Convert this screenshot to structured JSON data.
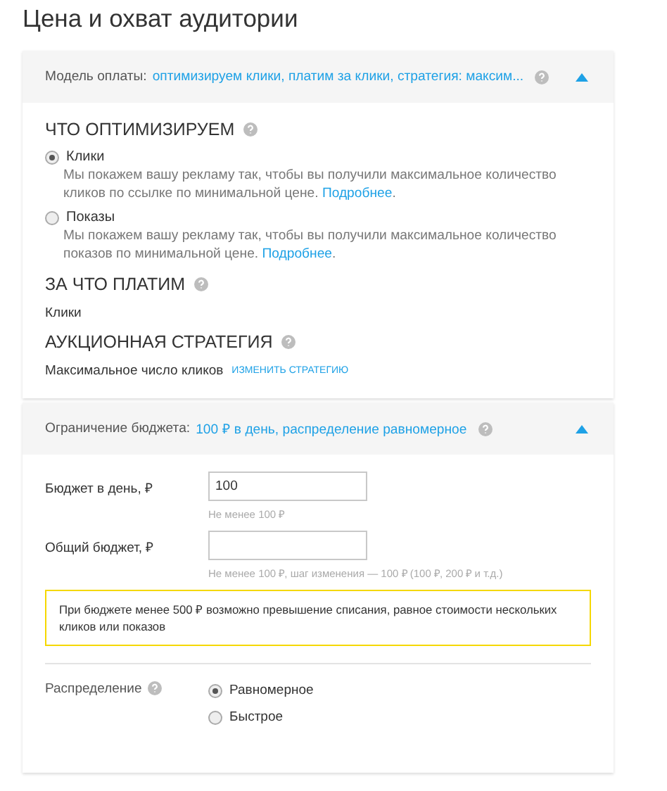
{
  "title": "Цена и охват аудитории",
  "payment": {
    "header_label": "Модель оплаты:",
    "header_value": "оптимизируем клики, платим за клики, стратегия: максим...",
    "expanded": true,
    "optimize": {
      "heading": "ЧТО ОПТИМИЗИРУЕМ",
      "options": [
        {
          "label": "Клики",
          "selected": true,
          "description": "Мы покажем вашу рекламу так, чтобы вы получили максимальное количество кликов по ссылке по минимальной цене.",
          "link": "Подробнее",
          "after_link": "."
        },
        {
          "label": "Показы",
          "selected": false,
          "description": "Мы покажем вашу рекламу так, чтобы вы получили максимальное количество показов по минимальной цене.",
          "link": "Подробнее",
          "after_link": "."
        }
      ]
    },
    "pay_for": {
      "heading": "ЗА ЧТО ПЛАТИМ",
      "value": "Клики"
    },
    "strategy": {
      "heading": "АУКЦИОННАЯ СТРАТЕГИЯ",
      "value": "Максимальное число кликов",
      "link": "ИЗМЕНИТЬ СТРАТЕГИЮ"
    }
  },
  "budget": {
    "header_label": "Ограничение бюджета:",
    "header_value": "100 ₽ в день, распределение равномерное",
    "expanded": true,
    "fields": [
      {
        "label": "Бюджет в день, ₽",
        "value": "100",
        "hint": "Не менее 100 ₽"
      },
      {
        "label": "Общий бюджет, ₽",
        "hint": "Не менее 100 ₽, шаг изменения — 100 ₽ (100 ₽, 200 ₽ и т.д.)"
      }
    ],
    "warning": "При бюджете менее 500 ₽ возможно превышение списания, равное стоимости нескольких кликов или показов",
    "distribution": {
      "label": "Распределение",
      "options": [
        {
          "label": "Равномерное",
          "selected": true
        },
        {
          "label": "Быстрое",
          "selected": false
        }
      ]
    }
  }
}
